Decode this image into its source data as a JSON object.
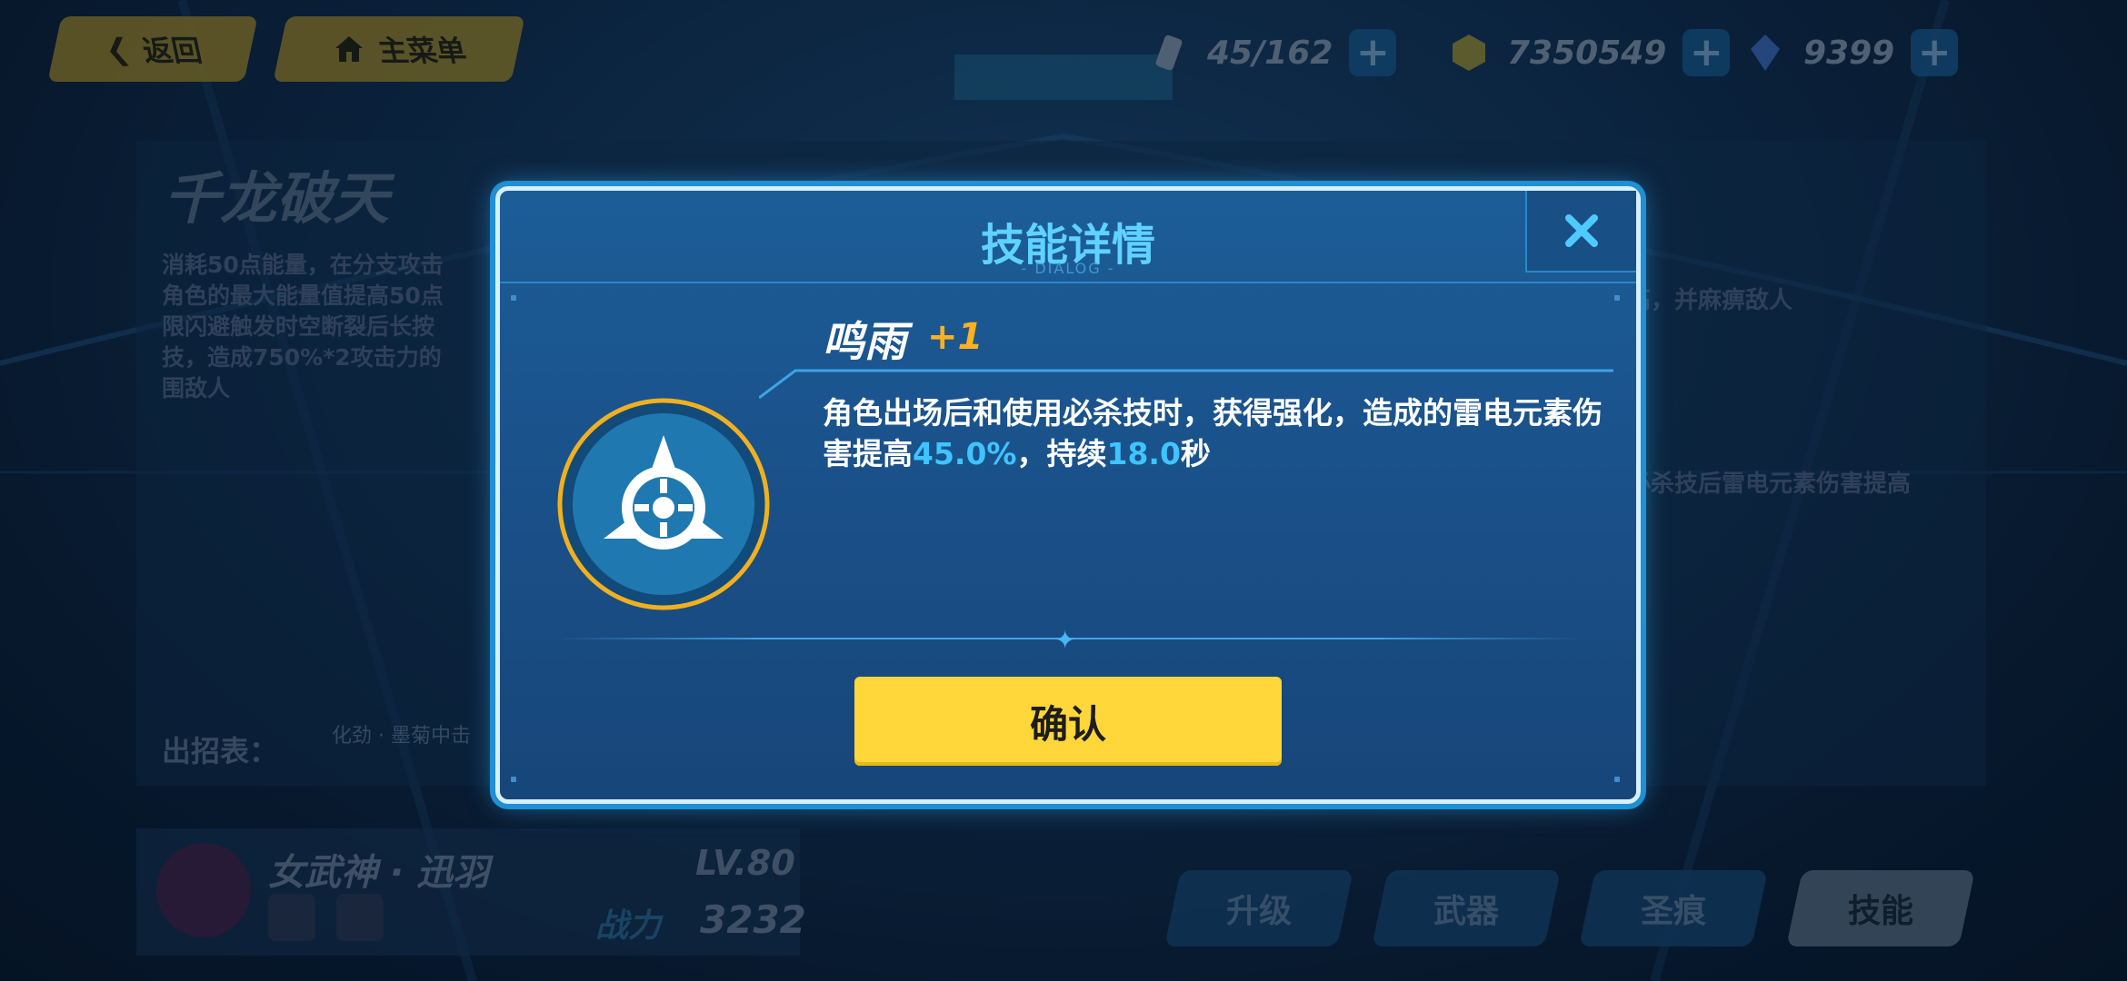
{
  "topbar": {
    "back_label": "返回",
    "menu_label": "主菜单",
    "resources": [
      {
        "icon": "stamina-icon",
        "value": "45/162"
      },
      {
        "icon": "coin-icon",
        "value": "7350549"
      },
      {
        "icon": "crystal-icon",
        "value": "9399"
      }
    ]
  },
  "background": {
    "skill_title": "千龙破天",
    "desc_lines": [
      "消耗50点能量，在分支攻击",
      "角色的最大能量值提高50点",
      "限闪避触发时空断裂后长按",
      "技，造成750%*2攻击力的",
      "围敌人"
    ],
    "right_text_1": "高，并麻痹敌人",
    "right_text_2": "必杀技后雷电元素伤害提高",
    "moves_label": "出招表：",
    "moves_text": "化劲 · 墨菊中击"
  },
  "character": {
    "name": "女武神 · 迅羽",
    "level": "LV.80",
    "power_label": "战力",
    "power": "3232"
  },
  "tabs": [
    {
      "label": "升级"
    },
    {
      "label": "武器"
    },
    {
      "label": "圣痕"
    },
    {
      "label": "技能"
    }
  ],
  "dialog": {
    "title": "技能详情",
    "subtitle": "- DIALOG -",
    "skill_name": "鸣雨",
    "skill_level": "+1",
    "desc_pre": "角色出场后和使用必杀技时，获得强化，造成的雷电元素伤害提高",
    "desc_value_1": "45.0%",
    "desc_mid": "，持续",
    "desc_value_2": "18.0",
    "desc_post": "秒",
    "confirm_label": "确认"
  },
  "colors": {
    "accent": "#5fd2ff",
    "highlight": "#3fc4ff",
    "level": "#ffb020",
    "confirm": "#ffd73a"
  }
}
